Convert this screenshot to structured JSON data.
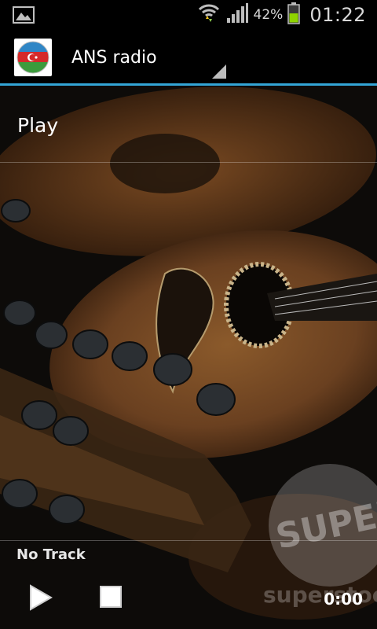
{
  "status_bar": {
    "notification_icon": "image-notification-icon",
    "wifi_icon": "wifi-icon",
    "signal_icon": "signal-icon",
    "battery_percent": "42%",
    "battery_icon": "battery-icon",
    "time": "01:22"
  },
  "action_bar": {
    "title": "ANS radio",
    "app_icon": "azerbaijan-flag-icon",
    "accent_color": "#33a5d6"
  },
  "list": {
    "items": [
      {
        "label": "Play"
      }
    ]
  },
  "player": {
    "track": "No Track",
    "play_icon": "play-icon",
    "stop_icon": "stop-icon",
    "elapsed": "0:00"
  }
}
